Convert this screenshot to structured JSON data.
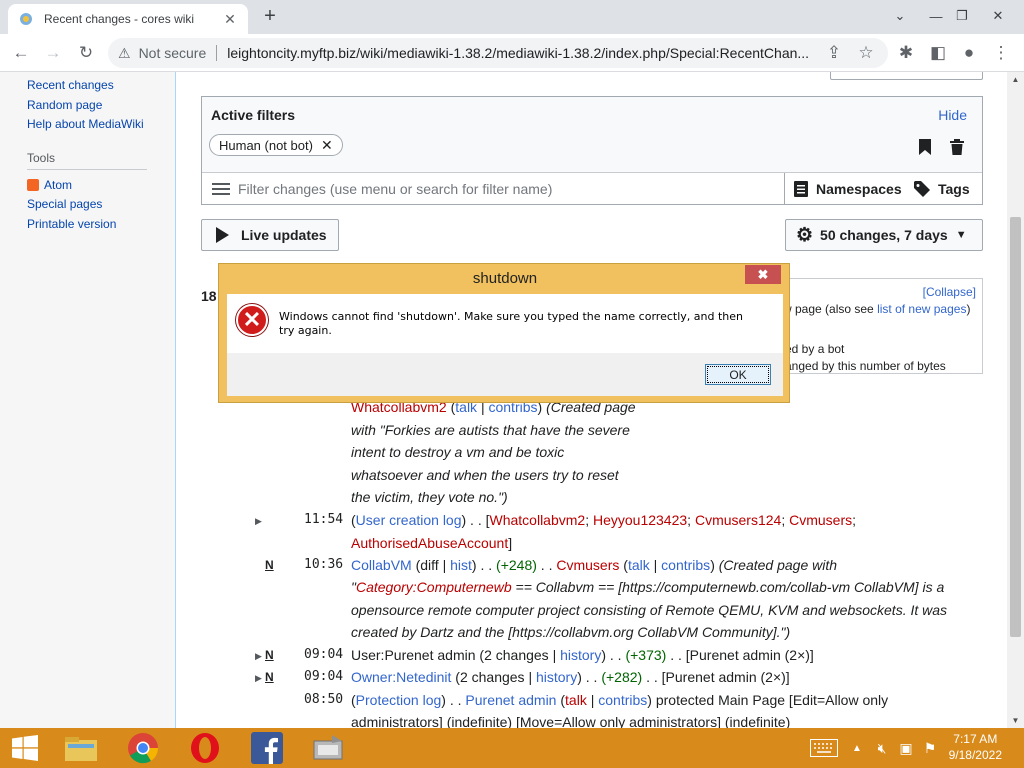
{
  "browser": {
    "tab_title": "Recent changes - cores wiki",
    "not_secure": "Not secure",
    "url": "leightoncity.myftp.biz/wiki/mediawiki-1.38.2/mediawiki-1.38.2/index.php/Special:RecentChan..."
  },
  "sidebar": {
    "items": [
      "Recent changes",
      "Random page",
      "Help about MediaWiki"
    ],
    "tools_heading": "Tools",
    "tools": [
      "Atom",
      "Special pages",
      "Printable version"
    ]
  },
  "filters": {
    "active_label": "Active filters",
    "hide": "Hide",
    "chip": "Human (not bot)",
    "placeholder": "Filter changes (use menu or search for filter name)",
    "namespaces": "Namespaces",
    "tags": "Tags"
  },
  "live_updates": "Live updates",
  "changes_summary": "50 changes, 7 days",
  "legend": {
    "collapse": "[Collapse]",
    "l1_pre": "w page (also see ",
    "l1_link": "list of new pages",
    "l1_post": ")",
    "l2": "ed by a bot",
    "l3": "anged by this number of bytes"
  },
  "day_heading": "18",
  "entries": {
    "e1": {
      "user": "Whatcollabvm2",
      "talk": "talk",
      "contribs": "contribs",
      "summary_lines": [
        "(Created page",
        "with \"Forkies are autists that have the severe",
        "intent to destroy a vm and be toxic",
        "whatsoever and when the users try to reset",
        "the victim, they vote no.\")"
      ]
    },
    "e2": {
      "time": "11:54",
      "log": "User creation log",
      "users": [
        "Whatcollabvm2",
        "Heyyou123423",
        "Cvmusers124",
        "Cvmusers",
        "AuthorisedAbuseAccount"
      ]
    },
    "e3": {
      "flag": "N",
      "time": "10:36",
      "page": "CollabVM",
      "diff": "diff",
      "hist": "hist",
      "size": "(+248)",
      "user": "Cvmusers",
      "talk": "talk",
      "contribs": "contribs",
      "s1": "(Created page with",
      "s2a": "\"",
      "s2link": "Category:Computernewb",
      "s2b": " == Collabvm == [https://computernewb.com/collab-vm CollabVM] is a",
      "s3": "opensource remote computer project consisting of Remote QEMU, KVM and websockets. It was",
      "s4": "created by Dartz and the [https://collabvm.org CollabVM Community].\")"
    },
    "e4": {
      "flag": "N",
      "time": "09:04",
      "page": "User:Purenet admin",
      "changes": "2 changes",
      "history": "history",
      "size": "(+373)",
      "users": "Purenet admin (2×)"
    },
    "e5": {
      "flag": "N",
      "time": "09:04",
      "page": "Owner:Netedinit",
      "changes": "2 changes",
      "history": "history",
      "size": "(+282)",
      "users": "Purenet admin (2×)"
    },
    "e6": {
      "time": "08:50",
      "log": "Protection log",
      "user": "Purenet admin",
      "talk": "talk",
      "contribs": "contribs",
      "action": " protected Main Page [Edit=Allow only",
      "action2": "administrators] (indefinite) [Move=Allow only administrators] (indefinite)"
    }
  },
  "dialog": {
    "title": "shutdown",
    "close": "✖",
    "message": "Windows cannot find 'shutdown'. Make sure you typed the name correctly, and then try again.",
    "ok": "OK"
  },
  "taskbar": {
    "time": "7:17 AM",
    "date": "9/18/2022"
  }
}
